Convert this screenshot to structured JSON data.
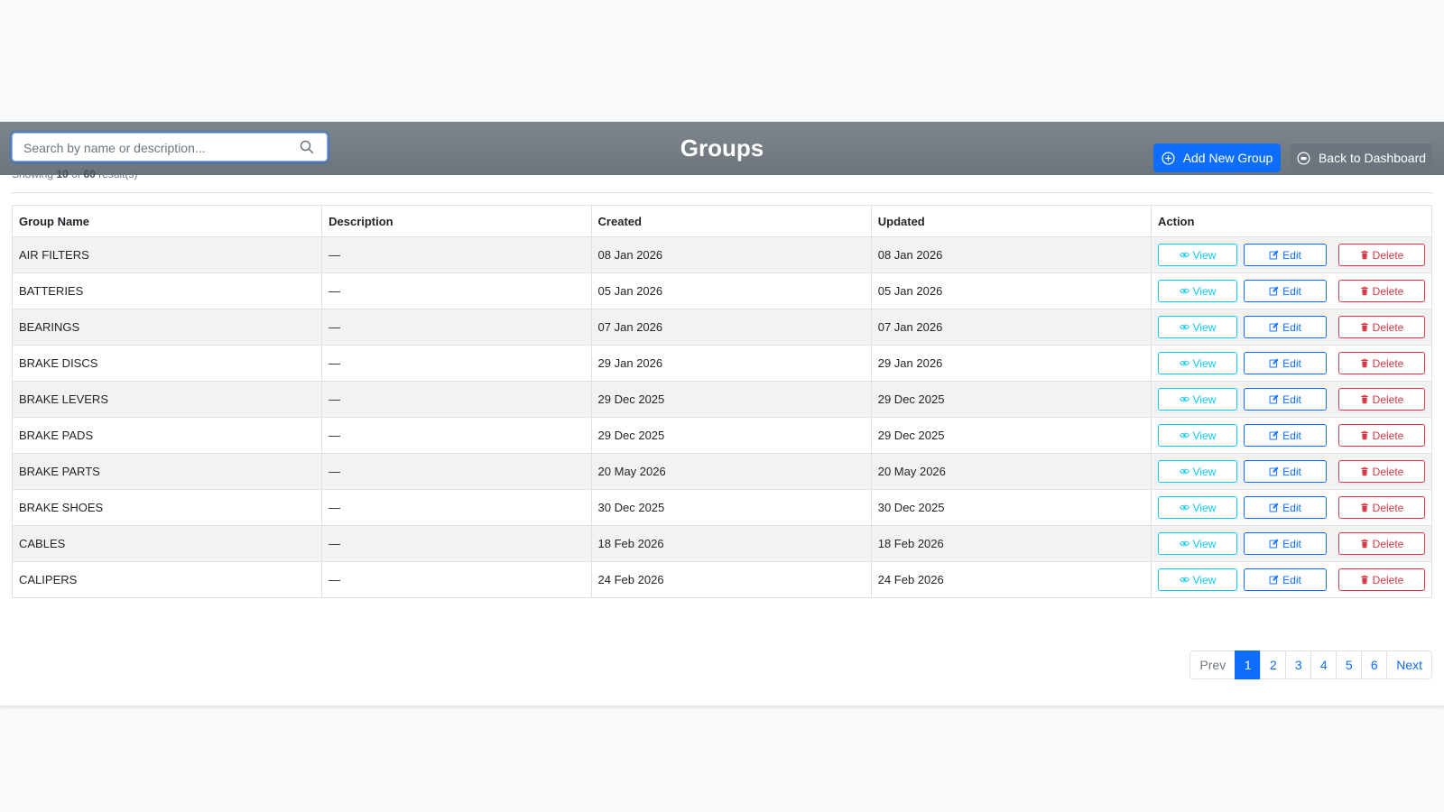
{
  "page": {
    "title": "Groups"
  },
  "search": {
    "placeholder": "Search by name or description...",
    "value": ""
  },
  "results": {
    "prefix": "Showing",
    "shown": "10",
    "of": "of",
    "total": "60",
    "suffix": "result(s)"
  },
  "buttons": {
    "add_new": "Add New Group",
    "back": "Back to Dashboard"
  },
  "table": {
    "headers": [
      "Group Name",
      "Description",
      "Created",
      "Updated",
      "Action"
    ],
    "rows": [
      {
        "name": "AIR FILTERS",
        "description": "—",
        "created": "08 Jan 2026",
        "updated": "08 Jan 2026"
      },
      {
        "name": "BATTERIES",
        "description": "—",
        "created": "05 Jan 2026",
        "updated": "05 Jan 2026"
      },
      {
        "name": "BEARINGS",
        "description": "—",
        "created": "07 Jan 2026",
        "updated": "07 Jan 2026"
      },
      {
        "name": "BRAKE DISCS",
        "description": "—",
        "created": "29 Jan 2026",
        "updated": "29 Jan 2026"
      },
      {
        "name": "BRAKE LEVERS",
        "description": "—",
        "created": "29 Dec 2025",
        "updated": "29 Dec 2025"
      },
      {
        "name": "BRAKE PADS",
        "description": "—",
        "created": "29 Dec 2025",
        "updated": "29 Dec 2025"
      },
      {
        "name": "BRAKE PARTS",
        "description": "—",
        "created": "20 May 2026",
        "updated": "20 May 2026"
      },
      {
        "name": "BRAKE SHOES",
        "description": "—",
        "created": "30 Dec 2025",
        "updated": "30 Dec 2025"
      },
      {
        "name": "CABLES",
        "description": "—",
        "created": "18 Feb 2026",
        "updated": "18 Feb 2026"
      },
      {
        "name": "CALIPERS",
        "description": "—",
        "created": "24 Feb 2026",
        "updated": "24 Feb 2026"
      }
    ],
    "actions": {
      "view": "View",
      "edit": "Edit",
      "delete": "Delete"
    }
  },
  "pagination": {
    "prev": "Prev",
    "pages": [
      "1",
      "2",
      "3",
      "4",
      "5",
      "6"
    ],
    "active": "1",
    "next": "Next"
  },
  "colors": {
    "header_bg": "#6c757d",
    "primary": "#0d6efd",
    "secondary": "#6c757d",
    "info": "#0dcaf0",
    "danger": "#dc3545"
  },
  "icons": {
    "search": "search-icon",
    "add": "plus-circle-icon",
    "back": "dashboard-icon",
    "view": "eye-icon",
    "edit": "pencil-square-icon",
    "delete": "trash-icon"
  }
}
